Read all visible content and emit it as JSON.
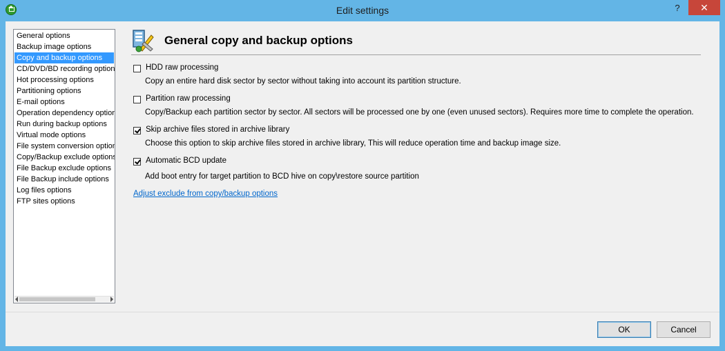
{
  "window": {
    "title": "Edit settings",
    "help_label": "?",
    "close_label": "✕"
  },
  "sidebar": {
    "items": [
      {
        "label": "General options"
      },
      {
        "label": "Backup image options"
      },
      {
        "label": "Copy and backup options",
        "selected": true
      },
      {
        "label": "CD/DVD/BD recording options"
      },
      {
        "label": "Hot processing options"
      },
      {
        "label": "Partitioning options"
      },
      {
        "label": "E-mail options"
      },
      {
        "label": "Operation dependency options"
      },
      {
        "label": "Run during backup options"
      },
      {
        "label": "Virtual mode options"
      },
      {
        "label": "File system conversion options"
      },
      {
        "label": "Copy/Backup exclude options"
      },
      {
        "label": "File Backup exclude options"
      },
      {
        "label": "File Backup include options"
      },
      {
        "label": "Log files options"
      },
      {
        "label": "FTP sites options"
      }
    ]
  },
  "main": {
    "title": "General copy and backup options",
    "options": [
      {
        "label": "HDD raw processing",
        "description": "Copy an entire hard disk sector by sector without taking into account its partition structure.",
        "checked": false
      },
      {
        "label": "Partition raw processing",
        "description": "Copy/Backup each partition sector by sector. All sectors will be processed one by one (even unused sectors). Requires more time to complete the operation.",
        "checked": false
      },
      {
        "label": "Skip archive files stored in archive library",
        "description": "Choose this option to skip archive files stored in archive library, This will reduce operation time and backup image size.",
        "checked": true
      },
      {
        "label": "Automatic BCD update",
        "description": "Add boot entry for target partition to BCD hive on copy\\restore source partition",
        "checked": true
      }
    ],
    "link": "Adjust exclude from copy/backup options"
  },
  "footer": {
    "ok_label": "OK",
    "cancel_label": "Cancel"
  },
  "colors": {
    "accent": "#63b5e6",
    "selection": "#3399ff",
    "link": "#0066cc",
    "close": "#c7463a"
  }
}
